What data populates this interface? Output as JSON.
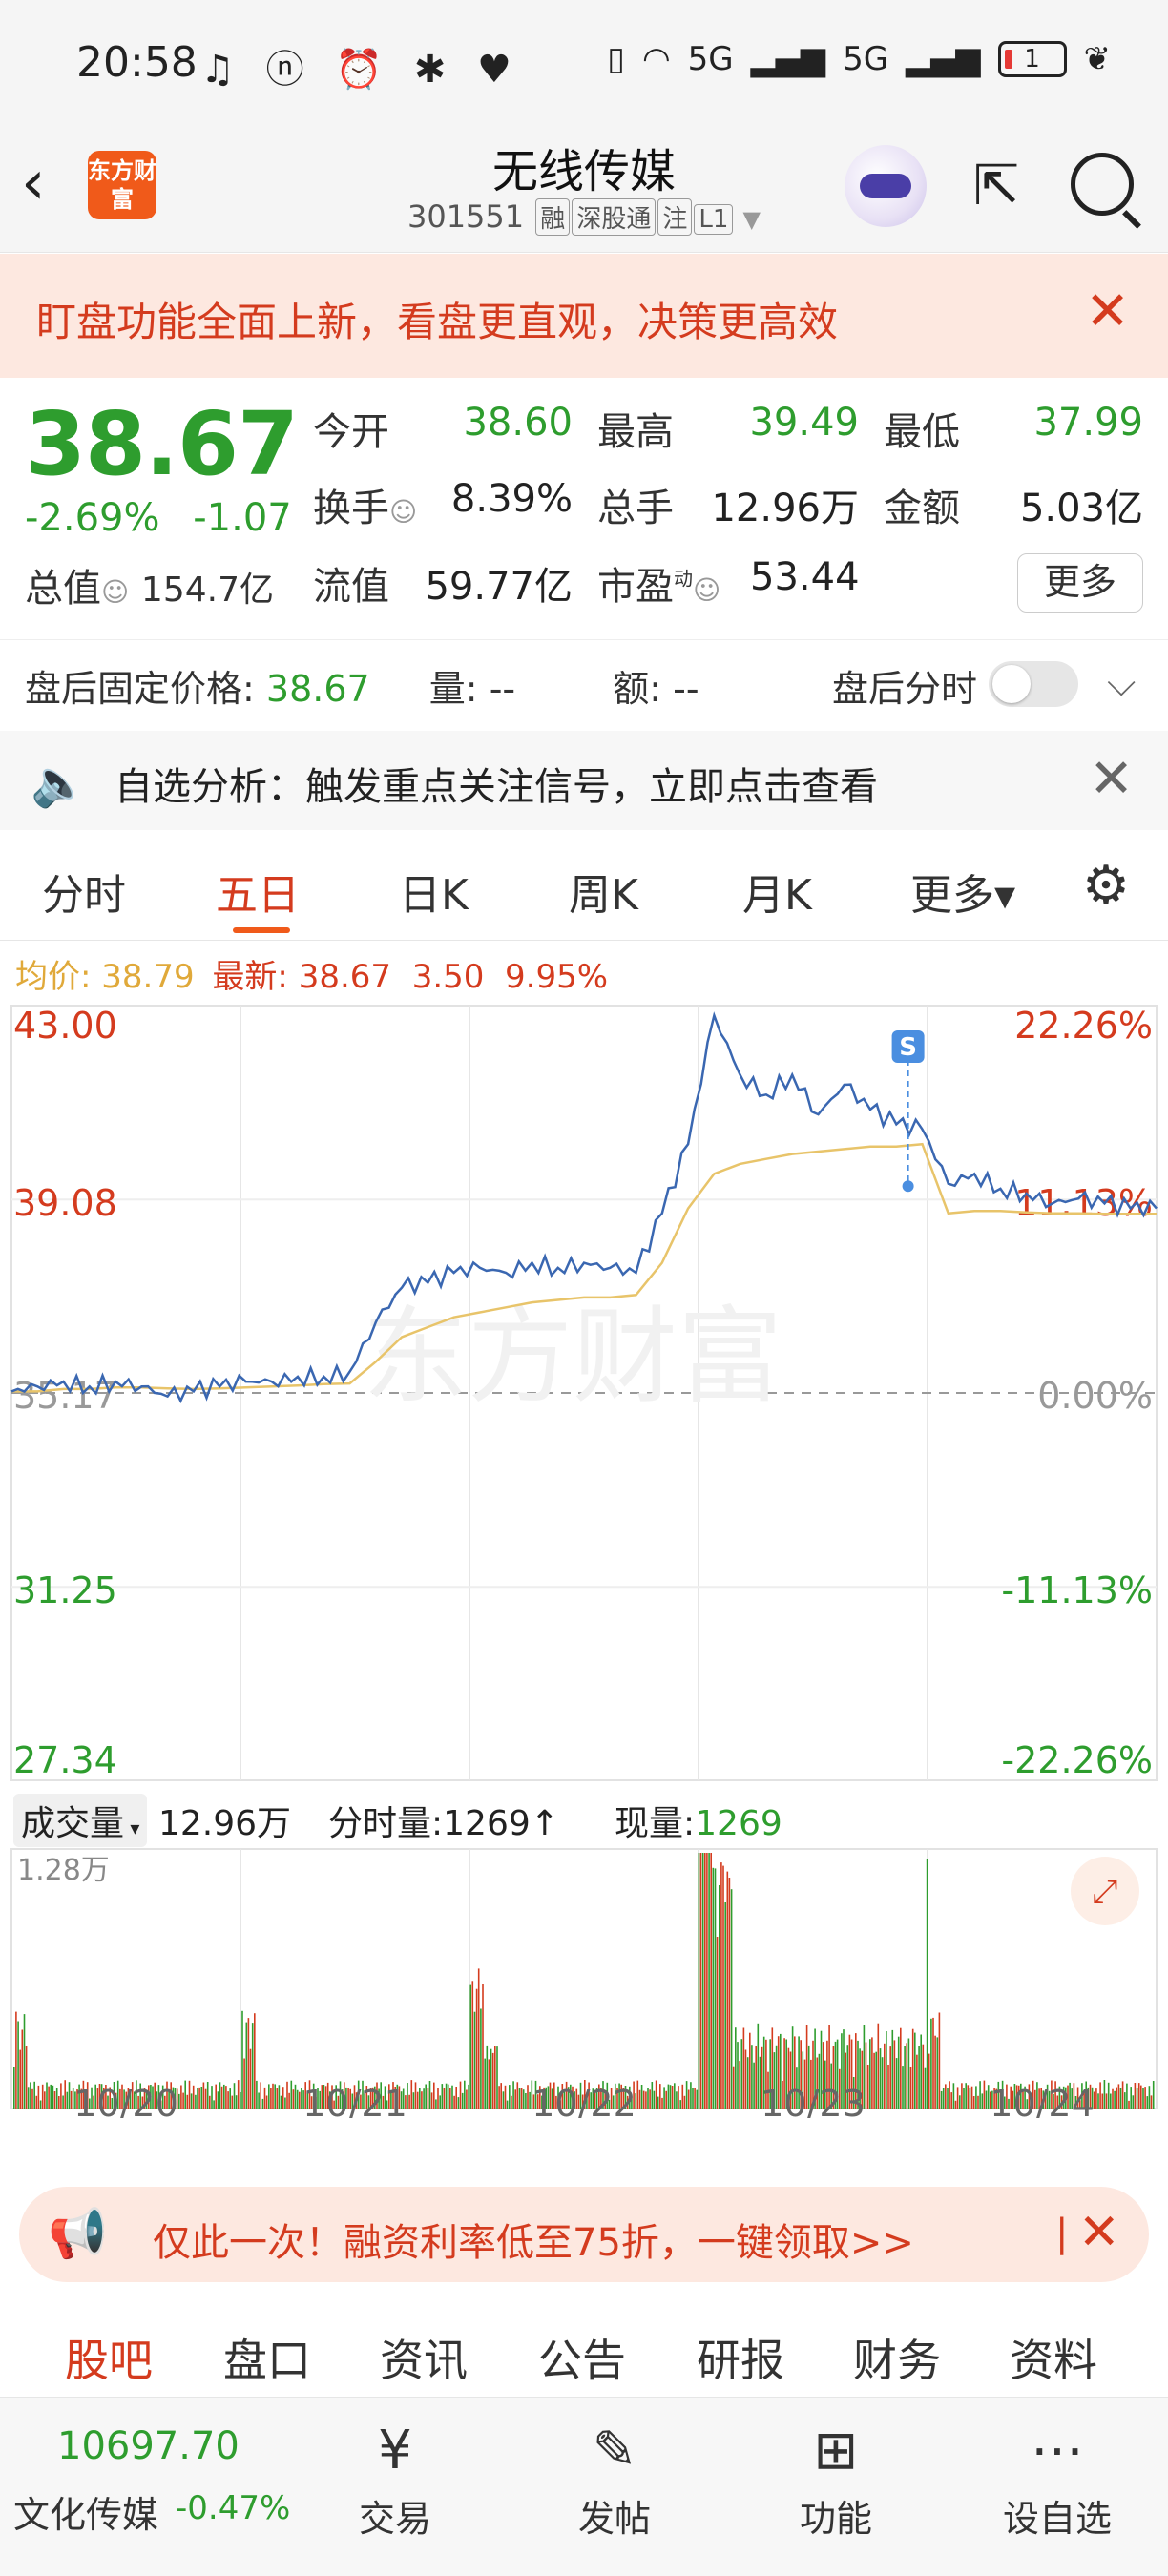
{
  "status_bar": {
    "time": "20:58",
    "network_1": "5G",
    "network_2": "5G",
    "battery": "1"
  },
  "header": {
    "logo_text": "东方财富",
    "stock_name": "无线传媒",
    "stock_code": "301551",
    "tags": [
      "融",
      "深股通",
      "注",
      "L1"
    ]
  },
  "banner": {
    "text": "盯盘功能全面上新，看盘更直观，决策更高效"
  },
  "quote": {
    "price": "38.67",
    "change_pct": "-2.69%",
    "change_abs": "-1.07",
    "market_cap_label": "总值",
    "market_cap": "154.7亿",
    "open_label": "今开",
    "open": "38.60",
    "high_label": "最高",
    "high": "39.49",
    "low_label": "最低",
    "low": "37.99",
    "turnover_label": "换手",
    "turnover": "8.39%",
    "volume_label": "总手",
    "volume": "12.96万",
    "amount_label": "金额",
    "amount": "5.03亿",
    "float_cap_label": "流值",
    "float_cap": "59.77亿",
    "pe_label": "市盈",
    "pe_sup": "动",
    "pe": "53.44",
    "more_label": "更多"
  },
  "after_hours": {
    "fixed_price_label": "盘后固定价格:",
    "fixed_price": "38.67",
    "vol_label": "量:",
    "vol": "--",
    "amt_label": "额:",
    "amt": "--",
    "timeshare_label": "盘后分时"
  },
  "alert": {
    "text": "自选分析：触发重点关注信号，立即点击查看"
  },
  "tabs": [
    "分时",
    "五日",
    "日K",
    "周K",
    "月K",
    "更多▾"
  ],
  "chart_info": {
    "avg_label": "均价:",
    "avg": "38.79",
    "latest_label": "最新:",
    "latest": "38.67",
    "latest_chg": "3.50",
    "latest_pct": "9.95%"
  },
  "chart_data": {
    "type": "line",
    "watermark": "东方财富",
    "y_left_labels": [
      "43.00",
      "39.08",
      "35.17",
      "31.25",
      "27.34"
    ],
    "y_right_labels": [
      "22.26%",
      "11.13%",
      "0.00%",
      "-11.13%",
      "-22.26%"
    ],
    "ylim": [
      27.34,
      43.0
    ],
    "prev_close": 35.17,
    "days": [
      "10/20",
      "10/21",
      "10/22",
      "10/23",
      "10/24"
    ],
    "marker": "S",
    "series": [
      {
        "name": "最新",
        "color": "#3a67b1",
        "values": [
          35.2,
          35.3,
          35.4,
          35.3,
          35.4,
          35.3,
          35.1,
          35.2,
          35.3,
          35.4,
          35.4,
          35.5,
          35.5,
          35.6,
          36.6,
          37.3,
          37.4,
          37.6,
          37.7,
          37.6,
          37.8,
          37.7,
          37.8,
          37.7,
          37.6,
          38.8,
          40.2,
          42.8,
          41.6,
          41.2,
          41.6,
          40.8,
          41.4,
          40.9,
          40.6,
          40.5,
          39.4,
          39.6,
          39.3,
          39.2,
          39.0,
          39.1,
          39.0,
          38.9,
          38.9
        ]
      },
      {
        "name": "均价",
        "color": "#e8c46a",
        "values": [
          35.2,
          35.2,
          35.25,
          35.25,
          35.28,
          35.28,
          35.26,
          35.25,
          35.26,
          35.28,
          35.3,
          35.32,
          35.35,
          35.36,
          35.8,
          36.3,
          36.5,
          36.7,
          36.8,
          36.9,
          37.0,
          37.05,
          37.1,
          37.1,
          37.15,
          37.8,
          38.9,
          39.6,
          39.8,
          39.9,
          40.0,
          40.05,
          40.1,
          40.15,
          40.15,
          40.2,
          38.8,
          38.85,
          38.85,
          38.82,
          38.8,
          38.8,
          38.79,
          38.79,
          38.79
        ]
      }
    ],
    "volume": {
      "label": "成交量",
      "total": "12.96万",
      "timeshare_label": "分时量:",
      "timeshare": "1269",
      "current_label": "现量:",
      "current": "1269",
      "ymax_label": "1.28万"
    }
  },
  "promo": {
    "text": "仅此一次！融资利率低至75折，一键领取>>"
  },
  "bottom_tabs": [
    "股吧",
    "盘口",
    "资讯",
    "公告",
    "研报",
    "财务",
    "资料"
  ],
  "bottom_bar": {
    "index_value": "10697.70",
    "index_name": "文化传媒",
    "index_change": "-0.47%",
    "buttons": [
      {
        "label": "交易",
        "icon": "trade-icon"
      },
      {
        "label": "发帖",
        "icon": "post-icon"
      },
      {
        "label": "功能",
        "icon": "function-icon"
      },
      {
        "label": "设自选",
        "icon": "add-watchlist-icon"
      }
    ]
  },
  "colors": {
    "up": "#d43b1e",
    "down": "#2e9d2e",
    "accent": "#f05a1a",
    "line": "#3a67b1",
    "avg": "#e8c46a"
  }
}
